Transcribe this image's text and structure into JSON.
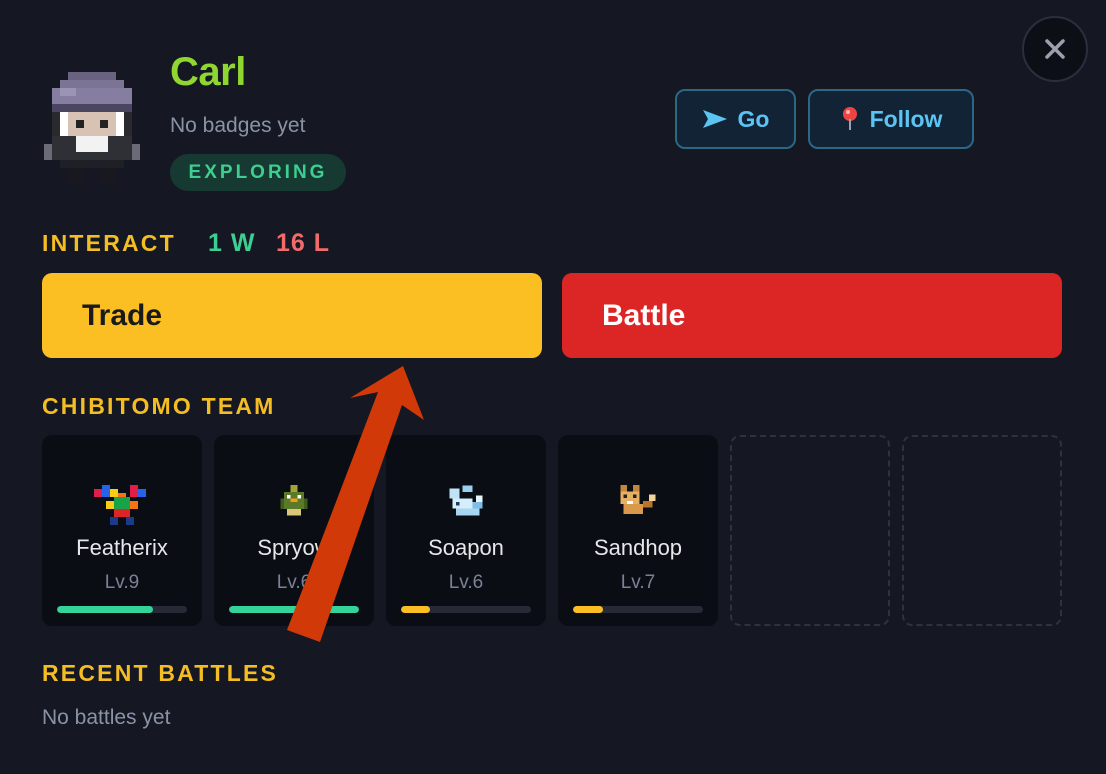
{
  "player": {
    "name": "Carl",
    "badges": "No badges yet",
    "status": "EXPLORING"
  },
  "actions": {
    "go": {
      "icon": "send-arrow-icon",
      "label": "Go"
    },
    "follow": {
      "icon": "pin-icon",
      "label": "Follow"
    },
    "close": {
      "icon": "close-icon"
    }
  },
  "interact": {
    "title": "INTERACT",
    "wins": "1 W",
    "losses": "16 L",
    "trade_label": "Trade",
    "battle_label": "Battle"
  },
  "team": {
    "title": "CHIBITOMO TEAM",
    "members": [
      {
        "name": "Featherix",
        "level": "Lv.9",
        "xp": 0.74,
        "bar_color": "#34d399"
      },
      {
        "name": "Spryow",
        "level": "Lv.6",
        "xp": 1.0,
        "bar_color": "#34d399"
      },
      {
        "name": "Soapon",
        "level": "Lv.6",
        "xp": 0.22,
        "bar_color": "#fbbf24"
      },
      {
        "name": "Sandhop",
        "level": "Lv.7",
        "xp": 0.23,
        "bar_color": "#fbbf24"
      }
    ],
    "empty_slots": 2
  },
  "recent_battles": {
    "title": "RECENT BATTLES",
    "empty_text": "No battles yet"
  },
  "colors": {
    "accent_gold": "#f5bd24",
    "name_green": "#8fd630",
    "win_green": "#3ccf91",
    "loss_red": "#f26b6b",
    "annotation_arrow": "#d13a08"
  }
}
